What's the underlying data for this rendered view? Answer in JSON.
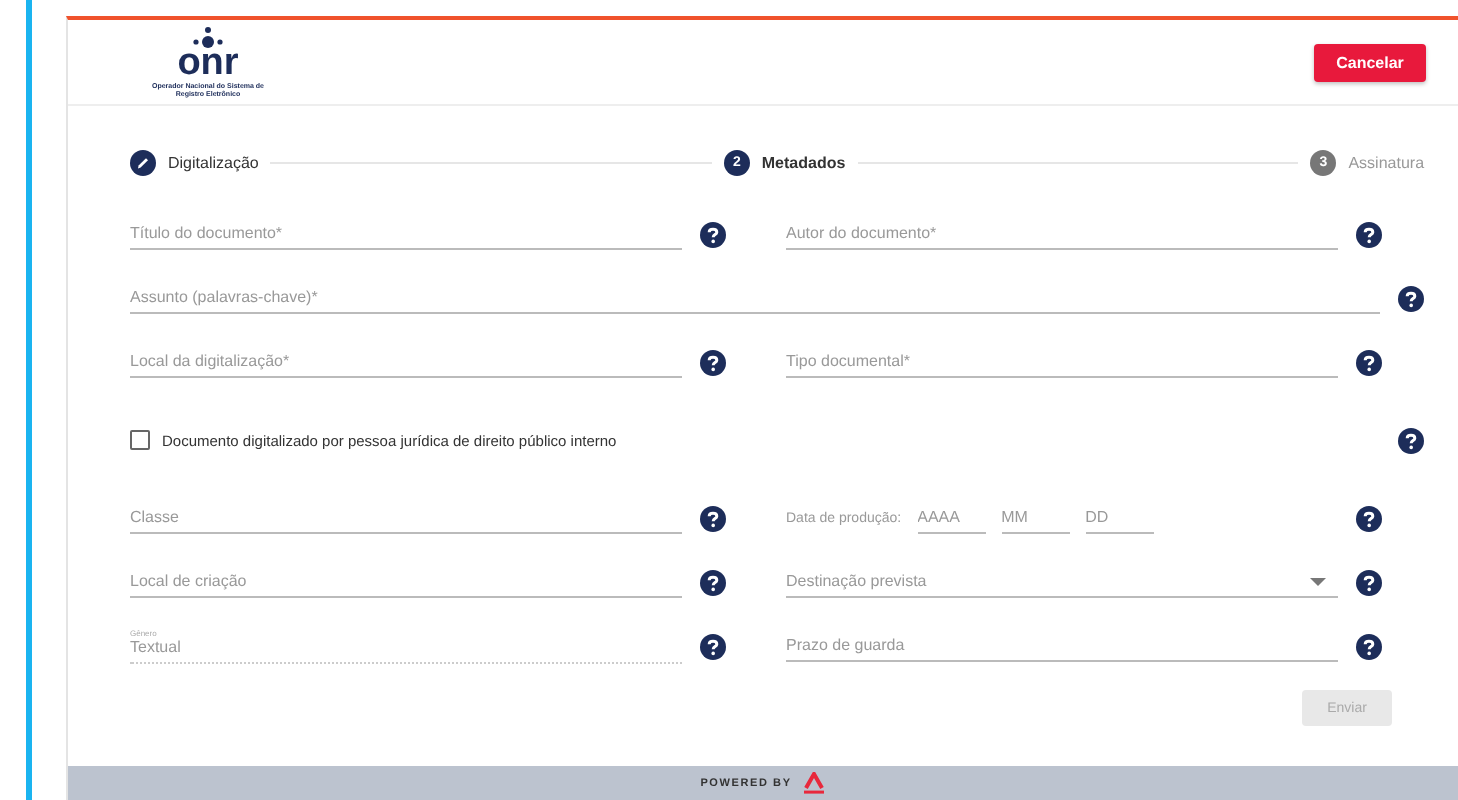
{
  "header": {
    "logo_text": "onr",
    "logo_caption": "Operador Nacional do Sistema de Registro Eletrônico",
    "cancel_button": "Cancelar"
  },
  "steps": [
    {
      "label": "Digitalização",
      "completed": true,
      "selected": false
    },
    {
      "label": "Metadados",
      "number": "2",
      "completed": false,
      "selected": true
    },
    {
      "label": "Assinatura",
      "number": "3",
      "completed": false,
      "selected": false
    }
  ],
  "rows": [
    [
      {
        "kind": "text",
        "placeholder": "Título do documento*"
      },
      {
        "kind": "text",
        "placeholder": "Autor do documento*"
      }
    ],
    [
      {
        "kind": "text",
        "placeholder": "Assunto (palavras-chave)*"
      }
    ],
    [
      {
        "kind": "text",
        "placeholder": "Local da digitalização*"
      },
      {
        "kind": "text",
        "placeholder": "Tipo documental*"
      }
    ],
    [
      {
        "kind": "checkbox",
        "label": "Documento digitalizado por pessoa jurídica de direito público interno",
        "checked": false
      }
    ],
    [
      {
        "kind": "text",
        "placeholder": "Classe"
      },
      {
        "kind": "date",
        "label": "Data de produção:",
        "parts": [
          {
            "placeholder": "AAAA"
          },
          {
            "placeholder": "MM"
          },
          {
            "placeholder": "DD"
          }
        ]
      }
    ],
    [
      {
        "kind": "text",
        "placeholder": "Local de criação"
      },
      {
        "kind": "select",
        "placeholder": "Destinação prevista"
      }
    ],
    [
      {
        "kind": "static",
        "label": "Gênero",
        "value": "Textual"
      },
      {
        "kind": "text",
        "placeholder": "Prazo de guarda"
      }
    ]
  ],
  "submit_button": {
    "label": "Enviar",
    "disabled": true
  },
  "footer": {
    "text": "POWERED BY"
  }
}
